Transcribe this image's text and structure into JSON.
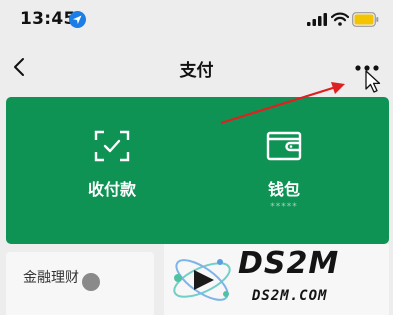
{
  "status_bar": {
    "time": "13:45",
    "icons": [
      "location-icon",
      "signal-icon",
      "wifi-icon",
      "battery-icon"
    ],
    "battery_color": "#f5c400"
  },
  "nav": {
    "title": "支付",
    "back_icon": "chevron-left-icon",
    "more_icon": "more-dots-icon"
  },
  "pay_card": {
    "background": "#0e9355",
    "items": [
      {
        "label": "收付款",
        "icon": "scan-check-icon"
      },
      {
        "label": "钱包",
        "sub": "*****",
        "icon": "wallet-icon"
      }
    ]
  },
  "finance": {
    "label": "金融理财"
  },
  "annotation": {
    "arrow_color": "#e02020"
  },
  "watermark": {
    "title": "DS2M",
    "subtitle": "DS2M.COM"
  }
}
